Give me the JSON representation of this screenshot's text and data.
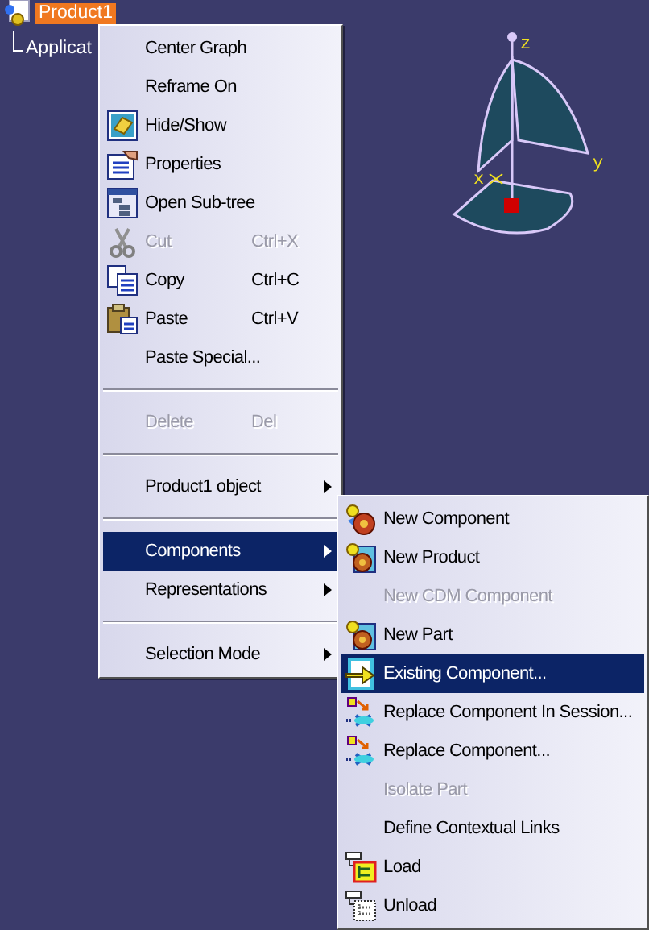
{
  "tree": [
    {
      "label": "Product1",
      "selected": true,
      "children": [
        {
          "label": "Applicat",
          "selected": false
        }
      ]
    }
  ],
  "axes": {
    "z": "z",
    "y": "y",
    "x": "x"
  },
  "context_menu": [
    {
      "kind": "item",
      "label": "Center Graph",
      "disabled": false,
      "selected": false
    },
    {
      "kind": "item",
      "label": "Reframe On",
      "disabled": false,
      "selected": false
    },
    {
      "kind": "item",
      "label": "Hide/Show",
      "disabled": false,
      "selected": false
    },
    {
      "kind": "item",
      "label": "Properties",
      "disabled": false,
      "selected": false
    },
    {
      "kind": "item",
      "label": "Open Sub-tree",
      "disabled": false,
      "selected": false
    },
    {
      "kind": "item",
      "label": "Cut",
      "shortcut": "Ctrl+X",
      "disabled": true,
      "selected": false
    },
    {
      "kind": "item",
      "label": "Copy",
      "shortcut": "Ctrl+C",
      "disabled": false,
      "selected": false
    },
    {
      "kind": "item",
      "label": "Paste",
      "shortcut": "Ctrl+V",
      "disabled": false,
      "selected": false
    },
    {
      "kind": "item",
      "label": "Paste Special...",
      "disabled": false,
      "selected": false
    },
    {
      "kind": "separator"
    },
    {
      "kind": "item",
      "label": "Delete",
      "shortcut": "Del",
      "disabled": true,
      "selected": false
    },
    {
      "kind": "separator"
    },
    {
      "kind": "submenu",
      "label": "Product1 object",
      "disabled": false,
      "selected": false
    },
    {
      "kind": "separator"
    },
    {
      "kind": "submenu",
      "label": "Components",
      "disabled": false,
      "selected": true
    },
    {
      "kind": "submenu",
      "label": "Representations",
      "disabled": false,
      "selected": false
    },
    {
      "kind": "separator"
    },
    {
      "kind": "submenu",
      "label": "Selection Mode",
      "disabled": false,
      "selected": false
    }
  ],
  "components_submenu": [
    {
      "kind": "item",
      "label": "New Component",
      "disabled": false,
      "selected": false
    },
    {
      "kind": "item",
      "label": "New Product",
      "disabled": false,
      "selected": false
    },
    {
      "kind": "item",
      "label": "New CDM Component",
      "disabled": true,
      "selected": false
    },
    {
      "kind": "item",
      "label": "New Part",
      "disabled": false,
      "selected": false
    },
    {
      "kind": "item",
      "label": "Existing Component...",
      "disabled": false,
      "selected": true
    },
    {
      "kind": "item",
      "label": "Replace Component In Session...",
      "disabled": false,
      "selected": false
    },
    {
      "kind": "item",
      "label": "Replace Component...",
      "disabled": false,
      "selected": false
    },
    {
      "kind": "item",
      "label": "Isolate Part",
      "disabled": true,
      "selected": false
    },
    {
      "kind": "item",
      "label": "Define Contextual Links",
      "disabled": false,
      "selected": false
    },
    {
      "kind": "item",
      "label": "Load",
      "disabled": false,
      "selected": false
    },
    {
      "kind": "item",
      "label": "Unload",
      "disabled": false,
      "selected": false
    }
  ]
}
